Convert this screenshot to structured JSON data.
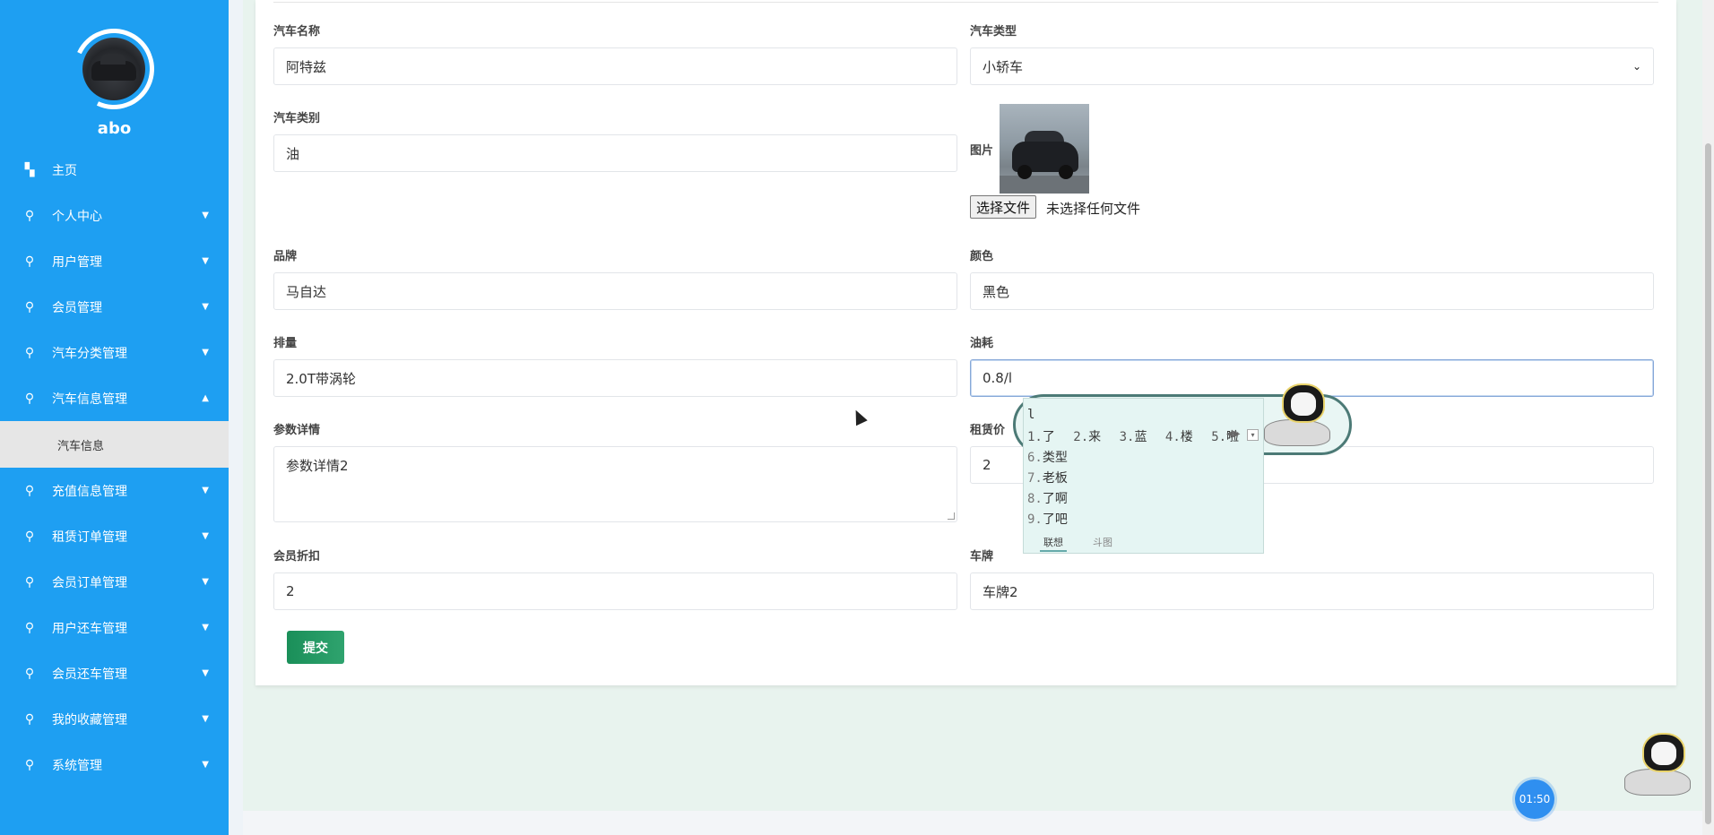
{
  "sidebar": {
    "username": "abo",
    "items": [
      {
        "label": "主页",
        "icon": "dashboard-icon",
        "has_chevron": false
      },
      {
        "label": "个人中心",
        "icon": "module-icon",
        "has_chevron": true
      },
      {
        "label": "用户管理",
        "icon": "module-icon",
        "has_chevron": true
      },
      {
        "label": "会员管理",
        "icon": "module-icon",
        "has_chevron": true
      },
      {
        "label": "汽车分类管理",
        "icon": "module-icon",
        "has_chevron": true
      },
      {
        "label": "汽车信息管理",
        "icon": "module-icon",
        "has_chevron": true,
        "expanded": true
      },
      {
        "label": "充值信息管理",
        "icon": "module-icon",
        "has_chevron": true
      },
      {
        "label": "租赁订单管理",
        "icon": "module-icon",
        "has_chevron": true
      },
      {
        "label": "会员订单管理",
        "icon": "module-icon",
        "has_chevron": true
      },
      {
        "label": "用户还车管理",
        "icon": "module-icon",
        "has_chevron": true
      },
      {
        "label": "会员还车管理",
        "icon": "module-icon",
        "has_chevron": true
      },
      {
        "label": "我的收藏管理",
        "icon": "module-icon",
        "has_chevron": true
      },
      {
        "label": "系统管理",
        "icon": "module-icon",
        "has_chevron": true
      }
    ],
    "submenu_active": "汽车信息"
  },
  "form": {
    "car_name": {
      "label": "汽车名称",
      "value": "阿特兹"
    },
    "car_type": {
      "label": "汽车类型",
      "value": "小轿车"
    },
    "car_category": {
      "label": "汽车类别",
      "value": "油"
    },
    "image": {
      "label": "图片",
      "button": "选择文件",
      "status": "未选择任何文件"
    },
    "brand": {
      "label": "品牌",
      "value": "马自达"
    },
    "color": {
      "label": "颜色",
      "value": "黑色"
    },
    "displacement": {
      "label": "排量",
      "value": "2.0T带涡轮"
    },
    "fuel": {
      "label": "油耗",
      "value": "0.8/l"
    },
    "params": {
      "label": "参数详情",
      "value": "参数详情2"
    },
    "rent_price": {
      "label": "租赁价",
      "value": "2"
    },
    "member_discount": {
      "label": "会员折扣",
      "value": "2"
    },
    "plate": {
      "label": "车牌",
      "value": "车牌2"
    },
    "submit": "提交"
  },
  "ime": {
    "composition": "l",
    "candidates_row": [
      {
        "n": "1.",
        "w": "了"
      },
      {
        "n": "2.",
        "w": "来"
      },
      {
        "n": "3.",
        "w": "蓝"
      },
      {
        "n": "4.",
        "w": "楼"
      },
      {
        "n": "5.",
        "w": "啦"
      }
    ],
    "candidates_list": [
      {
        "n": "6.",
        "w": "类型"
      },
      {
        "n": "7.",
        "w": "老板"
      },
      {
        "n": "8.",
        "w": "了啊"
      },
      {
        "n": "9.",
        "w": "了吧"
      }
    ],
    "tabs": [
      "联想",
      "斗图"
    ]
  },
  "timer": "01:50",
  "colors": {
    "sidebar": "#1e9ff2",
    "submit": "#1a8f59",
    "main_bg": "#e8f3ee"
  }
}
